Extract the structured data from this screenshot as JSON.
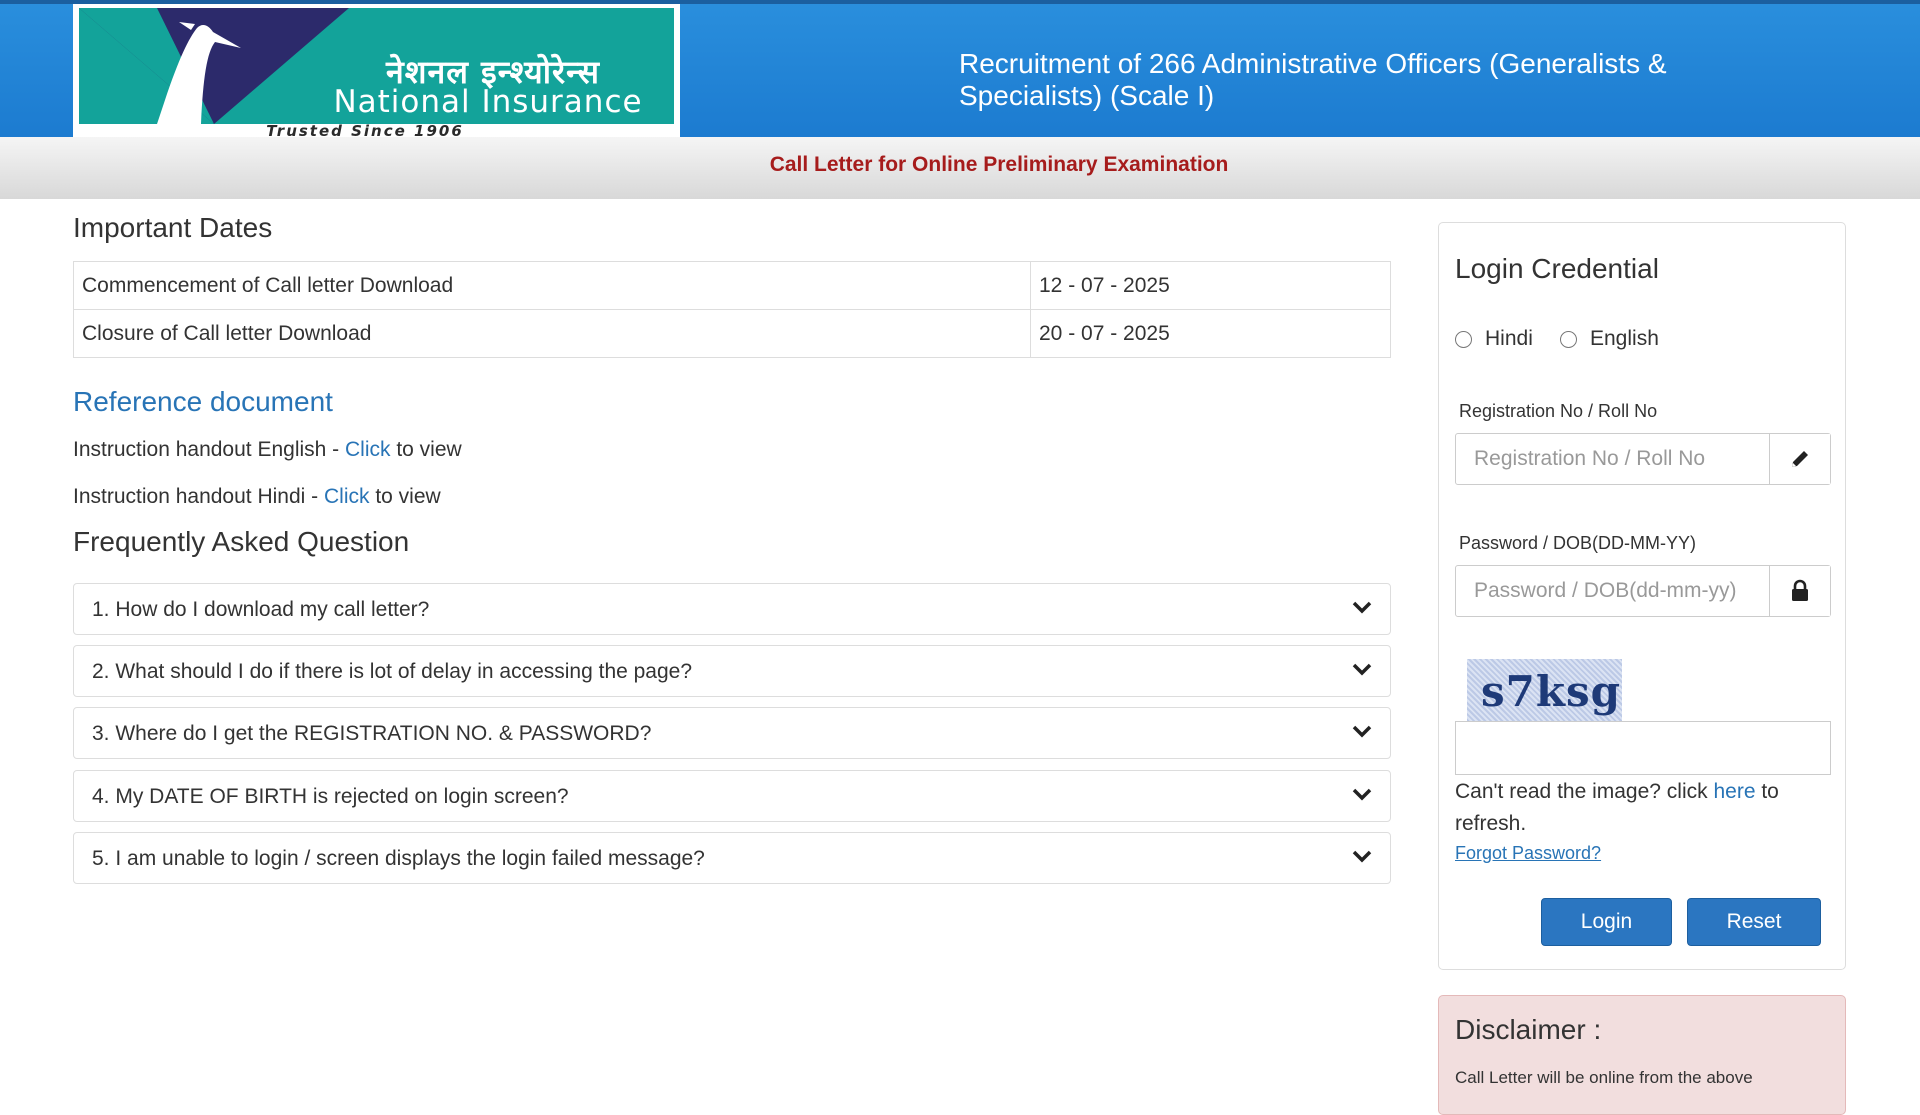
{
  "header": {
    "logo_hindi": "नेशनल इन्श्योरेन्स",
    "logo_english": "National Insurance",
    "logo_tagline": "Trusted Since 1906",
    "title": "Recruitment of 266 Administrative Officers (Generalists & Specialists) (Scale I)",
    "brand_blue": "#1c7bd0",
    "brand_teal": "#13a39a",
    "brand_navy": "#2c2a6b"
  },
  "subbar": {
    "text": "Call Letter for Online Preliminary Examination",
    "color": "#a61c1c"
  },
  "important_dates": {
    "title": "Important Dates",
    "rows": [
      {
        "label": "Commencement of Call letter Download",
        "value": "12 - 07 - 2025"
      },
      {
        "label": "Closure of Call letter Download",
        "value": "20 - 07 - 2025"
      }
    ]
  },
  "reference": {
    "title": "Reference document",
    "items": [
      {
        "prefix": "Instruction handout English - ",
        "link": "Click",
        "suffix": " to view"
      },
      {
        "prefix": "Instruction handout Hindi - ",
        "link": "Click",
        "suffix": " to view"
      }
    ]
  },
  "faq": {
    "title": "Frequently Asked Question",
    "items": [
      "1. How do I download my call letter?",
      "2. What should I do if there is lot of delay in accessing the page?",
      "3. Where do I get the REGISTRATION NO. & PASSWORD?",
      "4. My DATE OF BIRTH is rejected on login screen?",
      "5. I am unable to login / screen displays the login failed message?"
    ]
  },
  "login": {
    "title": "Login Credential",
    "languages": [
      "Hindi",
      "English"
    ],
    "reg_label": "Registration No / Roll No",
    "reg_placeholder": "Registration No / Roll No",
    "pwd_label": "Password / DOB(DD-MM-YY)",
    "pwd_placeholder": "Password / DOB(dd-mm-yy)",
    "captcha_text": "s7ksg",
    "refresh_prefix": "Can't read the image? click ",
    "refresh_link": "here",
    "refresh_suffix": " to refresh.",
    "forgot": "Forgot Password?",
    "login_button": "Login",
    "reset_button": "Reset"
  },
  "disclaimer": {
    "title": "Disclaimer :",
    "text": "Call Letter will be online from the above"
  }
}
